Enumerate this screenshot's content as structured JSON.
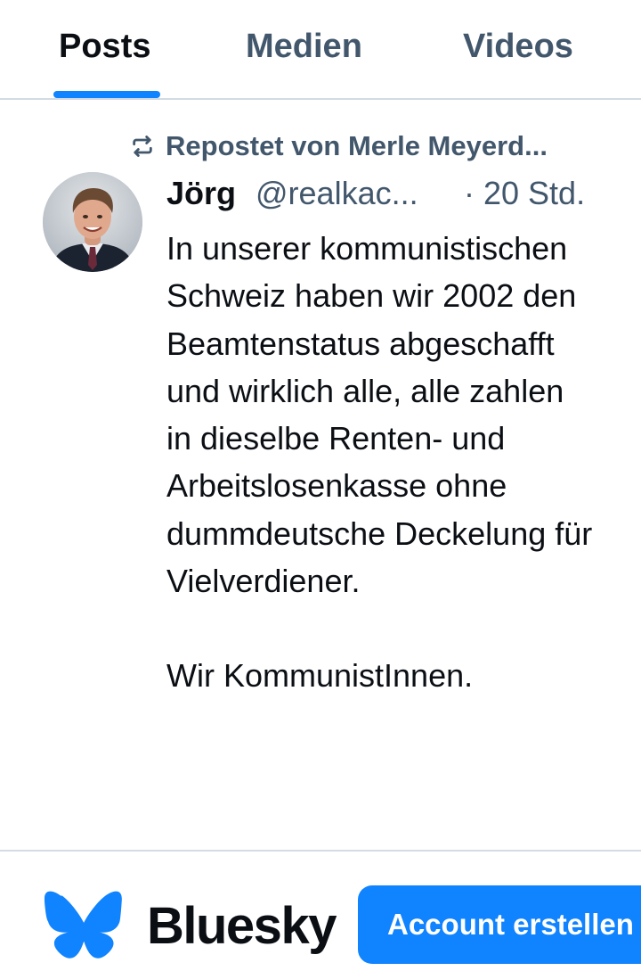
{
  "tabs": [
    {
      "label": "Posts",
      "active": true
    },
    {
      "label": "Medien",
      "active": false
    },
    {
      "label": "Videos",
      "active": false
    }
  ],
  "repost": {
    "icon": "repost-icon",
    "text": "Repostet von Merle Meyerd..."
  },
  "post": {
    "avatar": "avatar",
    "author_name": "Jörg",
    "author_handle": "@realkac...",
    "time": "· 20 Std.",
    "paragraph_1": "In unserer kommunistischen Schweiz haben wir 2002 den Beamtenstatus abgeschafft und wirklich alle, alle zahlen in dieselbe Renten- und Arbeitslosenkasse ohne dummdeutsche Deckelung für Vielverdiener.",
    "paragraph_2": "Wir KommunistInnen."
  },
  "footer": {
    "logo": "bluesky-butterfly-icon",
    "brand": "Bluesky",
    "signup_label": "Account erstellen"
  },
  "colors": {
    "accent": "#1083fe",
    "muted_text": "#42576c",
    "text": "#0b0f14",
    "divider": "#d4dbe2"
  }
}
